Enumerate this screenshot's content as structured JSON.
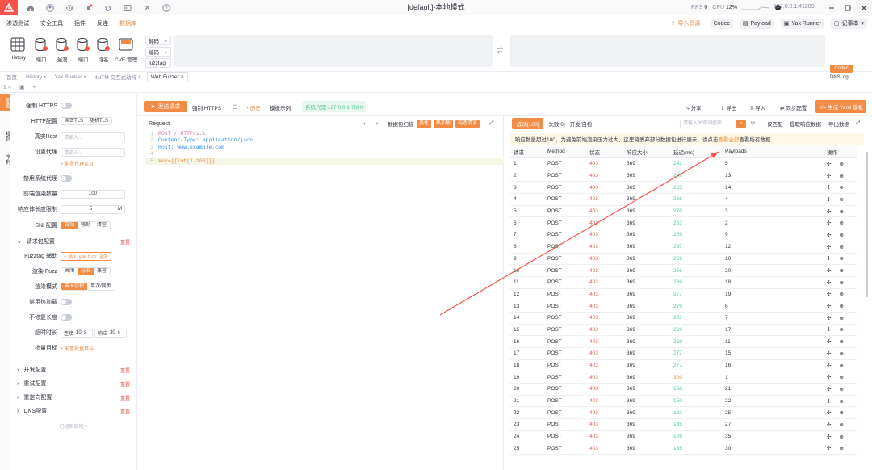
{
  "titlebar": {
    "title": "[default]-本地模式",
    "rps_label": "RPS",
    "rps_value": "0",
    "cpu_label": "CPU",
    "cpu_value": "12%",
    "host": "127.0.0.1:41289"
  },
  "menu": {
    "items": [
      "渗透测试",
      "安全工具",
      "插件",
      "反连",
      "数据库"
    ],
    "import_resource": "导入资源",
    "codec": "Codec",
    "payload": "Payload",
    "yak_runner": "Yak Runner",
    "notes": "记事本"
  },
  "toolbar": {
    "tools": [
      "History",
      "端口",
      "漏洞",
      "端口",
      "域名",
      "CVE 管理"
    ],
    "coder_options": [
      "解码",
      "编码",
      "fuzztag"
    ],
    "codec_btn": "Codec",
    "dnslog": "DNSLog"
  },
  "pagetabs": [
    "首页",
    "History",
    "Yak Runner",
    "MITM 交互式劫持",
    "Web Fuzzer"
  ],
  "vtabs": [
    "配置",
    "规则",
    "序列"
  ],
  "left": {
    "force_https": "强制 HTTPS",
    "http_config": "HTTP配置",
    "gm_tls": "国密TLS",
    "random_tls": "随机TLS",
    "real_host": "真实Host",
    "real_host_ph": "请输入...",
    "proxy": "设置代理",
    "proxy_ph": "请输入...",
    "proxy_link": "+ 配置代理认证",
    "disable_proxy": "禁用系统代理",
    "render_count": "前端渲染数量",
    "render_count_value": "100",
    "resp_limit": "响应体长度限制",
    "resp_limit_value": "5",
    "resp_limit_unit": "M",
    "sni": "SNI 配置",
    "sni_opts": [
      "自动",
      "强制",
      "清空"
    ],
    "req_pkg": "请求包配置",
    "reset": "重置",
    "fuzztag_help": "Fuzztag 辅助",
    "fuzztag_link": "+ 插入 yak.fuzz 语法",
    "render_fuzz": "渲染 Fuzz",
    "render_fuzz_opts": [
      "关闭",
      "标准",
      "兼容"
    ],
    "render_mode": "渲染模式",
    "render_mode_opts": [
      "笛卡尔积",
      "单次/同步"
    ],
    "disable_hot": "禁用热加载",
    "no_fix_len": "不修复长度",
    "timeout": "超时时长",
    "conn_label": "连接",
    "conn_value": "10",
    "conn_unit": "s",
    "resp_label": "响应",
    "resp_value": "30",
    "resp_unit": "s",
    "batch": "批量目标",
    "batch_link": "+ 配置批量目标",
    "sections": [
      "开发配置",
      "重试配置",
      "重定向配置",
      "DNS配置"
    ],
    "bottom": "已经到底啦～"
  },
  "request": {
    "send": "发送请求",
    "force_https": "强制 HTTPS",
    "history": "历史",
    "example": "模板示例",
    "proxy_tag": "系统代理:127.0.0.1:7890",
    "title": "Request",
    "fuzz_label": "数据包扫描",
    "tags": [
      "美化",
      "热加载",
      "构造请求"
    ],
    "lines": [
      {
        "n": "1",
        "t": "POST / HTTP/1.1"
      },
      {
        "n": "2",
        "t": "Content-Type: application/json"
      },
      {
        "n": "3",
        "t": "Host: www.example.com"
      },
      {
        "n": "4",
        "t": ""
      },
      {
        "n": "5",
        "t": "key={{int(1-100)}}"
      }
    ]
  },
  "right_actions": [
    "分享",
    "导出",
    "导入",
    "同步配置",
    "生成 Yaml 模板"
  ],
  "response": {
    "tabs": [
      "成功[100]",
      "失败[0]",
      "开发/自检"
    ],
    "search_ph": "请输入关键词搜索",
    "btns": [
      "仅匹配",
      "提取响应数据",
      "导出数据"
    ],
    "notice_pre": "响应数量超过100，为避免前端渲染压力过大，这里将丢弃部分数据包进行展示，请点击",
    "notice_link": "查看全部",
    "notice_post": "查看所有数据",
    "headers": [
      "请求",
      "Method",
      "状态",
      "响应大小",
      "延迟(ms)",
      "Payloads",
      "操作"
    ],
    "rows": [
      [
        "1",
        "POST",
        "403",
        "369",
        "242",
        "5"
      ],
      [
        "2",
        "POST",
        "403",
        "369",
        "249",
        "13"
      ],
      [
        "3",
        "POST",
        "403",
        "369",
        "255",
        "14"
      ],
      [
        "4",
        "POST",
        "403",
        "369",
        "268",
        "4"
      ],
      [
        "5",
        "POST",
        "403",
        "369",
        "270",
        "3"
      ],
      [
        "6",
        "POST",
        "403",
        "369",
        "263",
        "2"
      ],
      [
        "7",
        "POST",
        "403",
        "369",
        "269",
        "9"
      ],
      [
        "8",
        "POST",
        "403",
        "369",
        "267",
        "12"
      ],
      [
        "9",
        "POST",
        "403",
        "369",
        "269",
        "10"
      ],
      [
        "10",
        "POST",
        "403",
        "369",
        "256",
        "20"
      ],
      [
        "11",
        "POST",
        "403",
        "369",
        "269",
        "18"
      ],
      [
        "12",
        "POST",
        "403",
        "369",
        "277",
        "19"
      ],
      [
        "13",
        "POST",
        "403",
        "369",
        "279",
        "6"
      ],
      [
        "14",
        "POST",
        "403",
        "369",
        "281",
        "7"
      ],
      [
        "15",
        "POST",
        "403",
        "369",
        "269",
        "17"
      ],
      [
        "16",
        "POST",
        "403",
        "369",
        "269",
        "11"
      ],
      [
        "17",
        "POST",
        "403",
        "369",
        "277",
        "15"
      ],
      [
        "18",
        "POST",
        "403",
        "369",
        "277",
        "16"
      ],
      [
        "19",
        "POST",
        "403",
        "369",
        "300",
        "1"
      ],
      [
        "20",
        "POST",
        "403",
        "369",
        "158",
        "21"
      ],
      [
        "21",
        "POST",
        "403",
        "369",
        "150",
        "22"
      ],
      [
        "22",
        "POST",
        "403",
        "369",
        "122",
        "25"
      ],
      [
        "23",
        "POST",
        "403",
        "369",
        "135",
        "27"
      ],
      [
        "24",
        "POST",
        "403",
        "369",
        "126",
        "35"
      ],
      [
        "25",
        "POST",
        "403",
        "369",
        "135",
        "30"
      ]
    ]
  },
  "colors": {
    "accent": "#f28b44",
    "danger": "#f6544a",
    "success": "#56c991"
  }
}
